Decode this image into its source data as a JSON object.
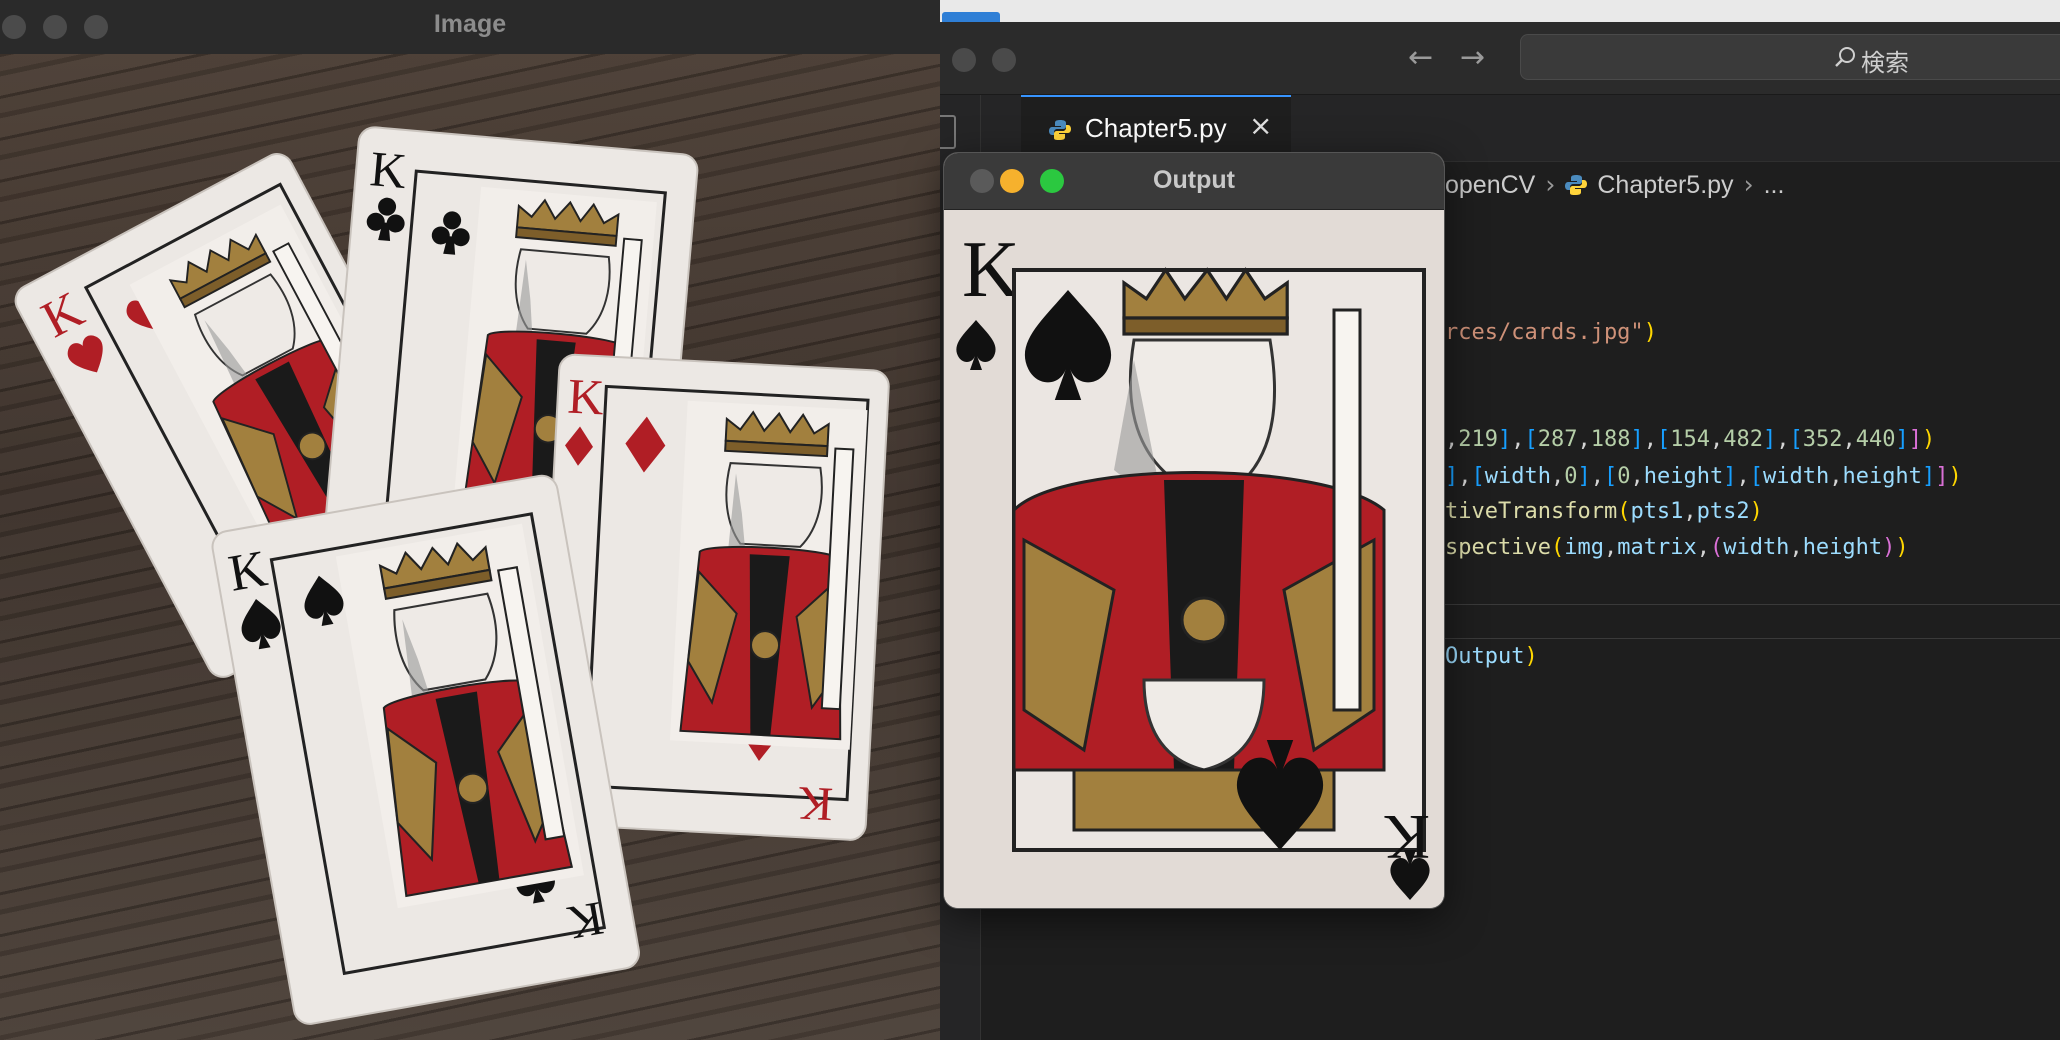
{
  "image_window": {
    "title": "Image",
    "traffic_lights": [
      "close",
      "minimize",
      "zoom"
    ],
    "content": "photo of four king playing cards on a wooden table"
  },
  "output_window": {
    "title": "Output",
    "traffic_lights": [
      "close",
      "minimize",
      "zoom"
    ],
    "traffic_light_colors": [
      "#5a5a5a",
      "#f6b12d",
      "#2bc840"
    ]
  },
  "card_text": {
    "rank": "K"
  },
  "vscode": {
    "nav_back": "←",
    "nav_forward": "→",
    "search_label": "検索",
    "tab": {
      "name": "Chapter5.py",
      "close_glyph": "×",
      "icon": "python-icon"
    },
    "breadcrumb": {
      "folder": "openCV",
      "file": "Chapter5.py",
      "more": "..."
    },
    "code": {
      "line1_str": "rces/cards.jpg\"",
      "pts1": [
        "219",
        "287",
        "188",
        "154",
        "482",
        "352",
        "440"
      ],
      "pts2_vars": [
        "width",
        "0",
        "0",
        "height",
        "width",
        "height"
      ],
      "line4_fn": "tiveTransform",
      "line4_args": [
        "pts1",
        "pts2"
      ],
      "line5_fn": "spective",
      "line5_args": [
        "img",
        "matrix",
        "width",
        "height"
      ],
      "line6_var": "Output"
    }
  },
  "colors": {
    "accent": "#3794ff",
    "heart_red": "#b01e25",
    "gold": "#a2803e"
  }
}
